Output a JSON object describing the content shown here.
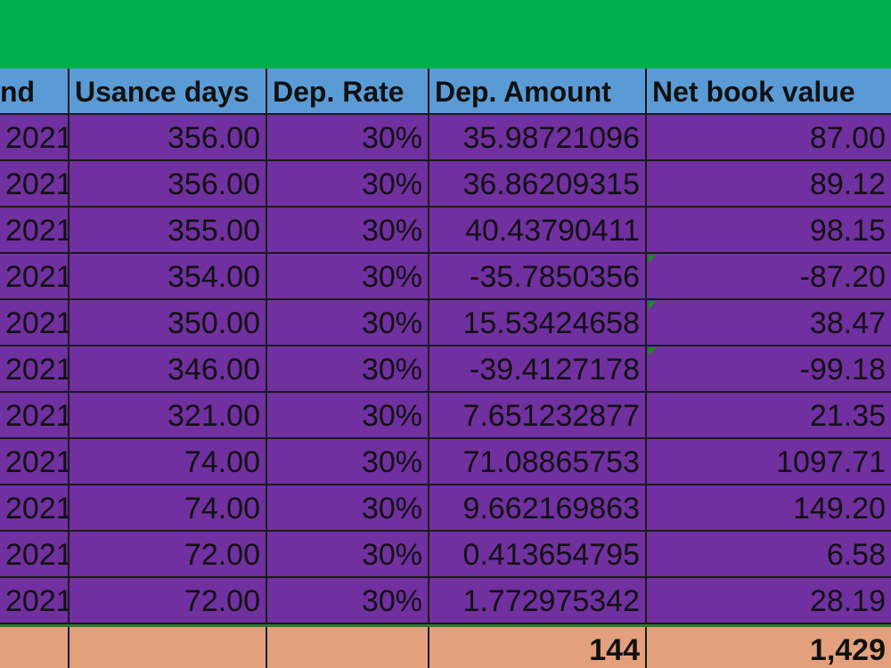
{
  "sheet": {
    "header_fill": "#5b9bd5",
    "data_fill": "#7030a0",
    "total_fill": "#e4a07c",
    "band_fill": "#00b050"
  },
  "columns": [
    "nd",
    "Usance days",
    "Dep. Rate",
    "Dep. Amount",
    "Net book value"
  ],
  "rows": [
    {
      "end": "2021",
      "usance": "356.00",
      "rate": "30%",
      "amount": "35.98721096",
      "nbv": "87.00",
      "warn": false
    },
    {
      "end": "2021",
      "usance": "356.00",
      "rate": "30%",
      "amount": "36.86209315",
      "nbv": "89.12",
      "warn": false
    },
    {
      "end": "2021",
      "usance": "355.00",
      "rate": "30%",
      "amount": "40.43790411",
      "nbv": "98.15",
      "warn": false
    },
    {
      "end": "2021",
      "usance": "354.00",
      "rate": "30%",
      "amount": "-35.7850356",
      "nbv": "-87.20",
      "warn": true
    },
    {
      "end": "2021",
      "usance": "350.00",
      "rate": "30%",
      "amount": "15.53424658",
      "nbv": "38.47",
      "warn": true
    },
    {
      "end": "2021",
      "usance": "346.00",
      "rate": "30%",
      "amount": "-39.4127178",
      "nbv": "-99.18",
      "warn": true
    },
    {
      "end": "2021",
      "usance": "321.00",
      "rate": "30%",
      "amount": "7.651232877",
      "nbv": "21.35",
      "warn": false
    },
    {
      "end": "2021",
      "usance": "74.00",
      "rate": "30%",
      "amount": "71.08865753",
      "nbv": "1097.71",
      "warn": false
    },
    {
      "end": "2021",
      "usance": "74.00",
      "rate": "30%",
      "amount": "9.662169863",
      "nbv": "149.20",
      "warn": false
    },
    {
      "end": "2021",
      "usance": "72.00",
      "rate": "30%",
      "amount": "0.413654795",
      "nbv": "6.58",
      "warn": false
    },
    {
      "end": "2021",
      "usance": "72.00",
      "rate": "30%",
      "amount": "1.772975342",
      "nbv": "28.19",
      "warn": false
    }
  ],
  "totals": {
    "end": "",
    "usance": "",
    "rate": "",
    "amount": "144",
    "nbv": "1,429"
  }
}
